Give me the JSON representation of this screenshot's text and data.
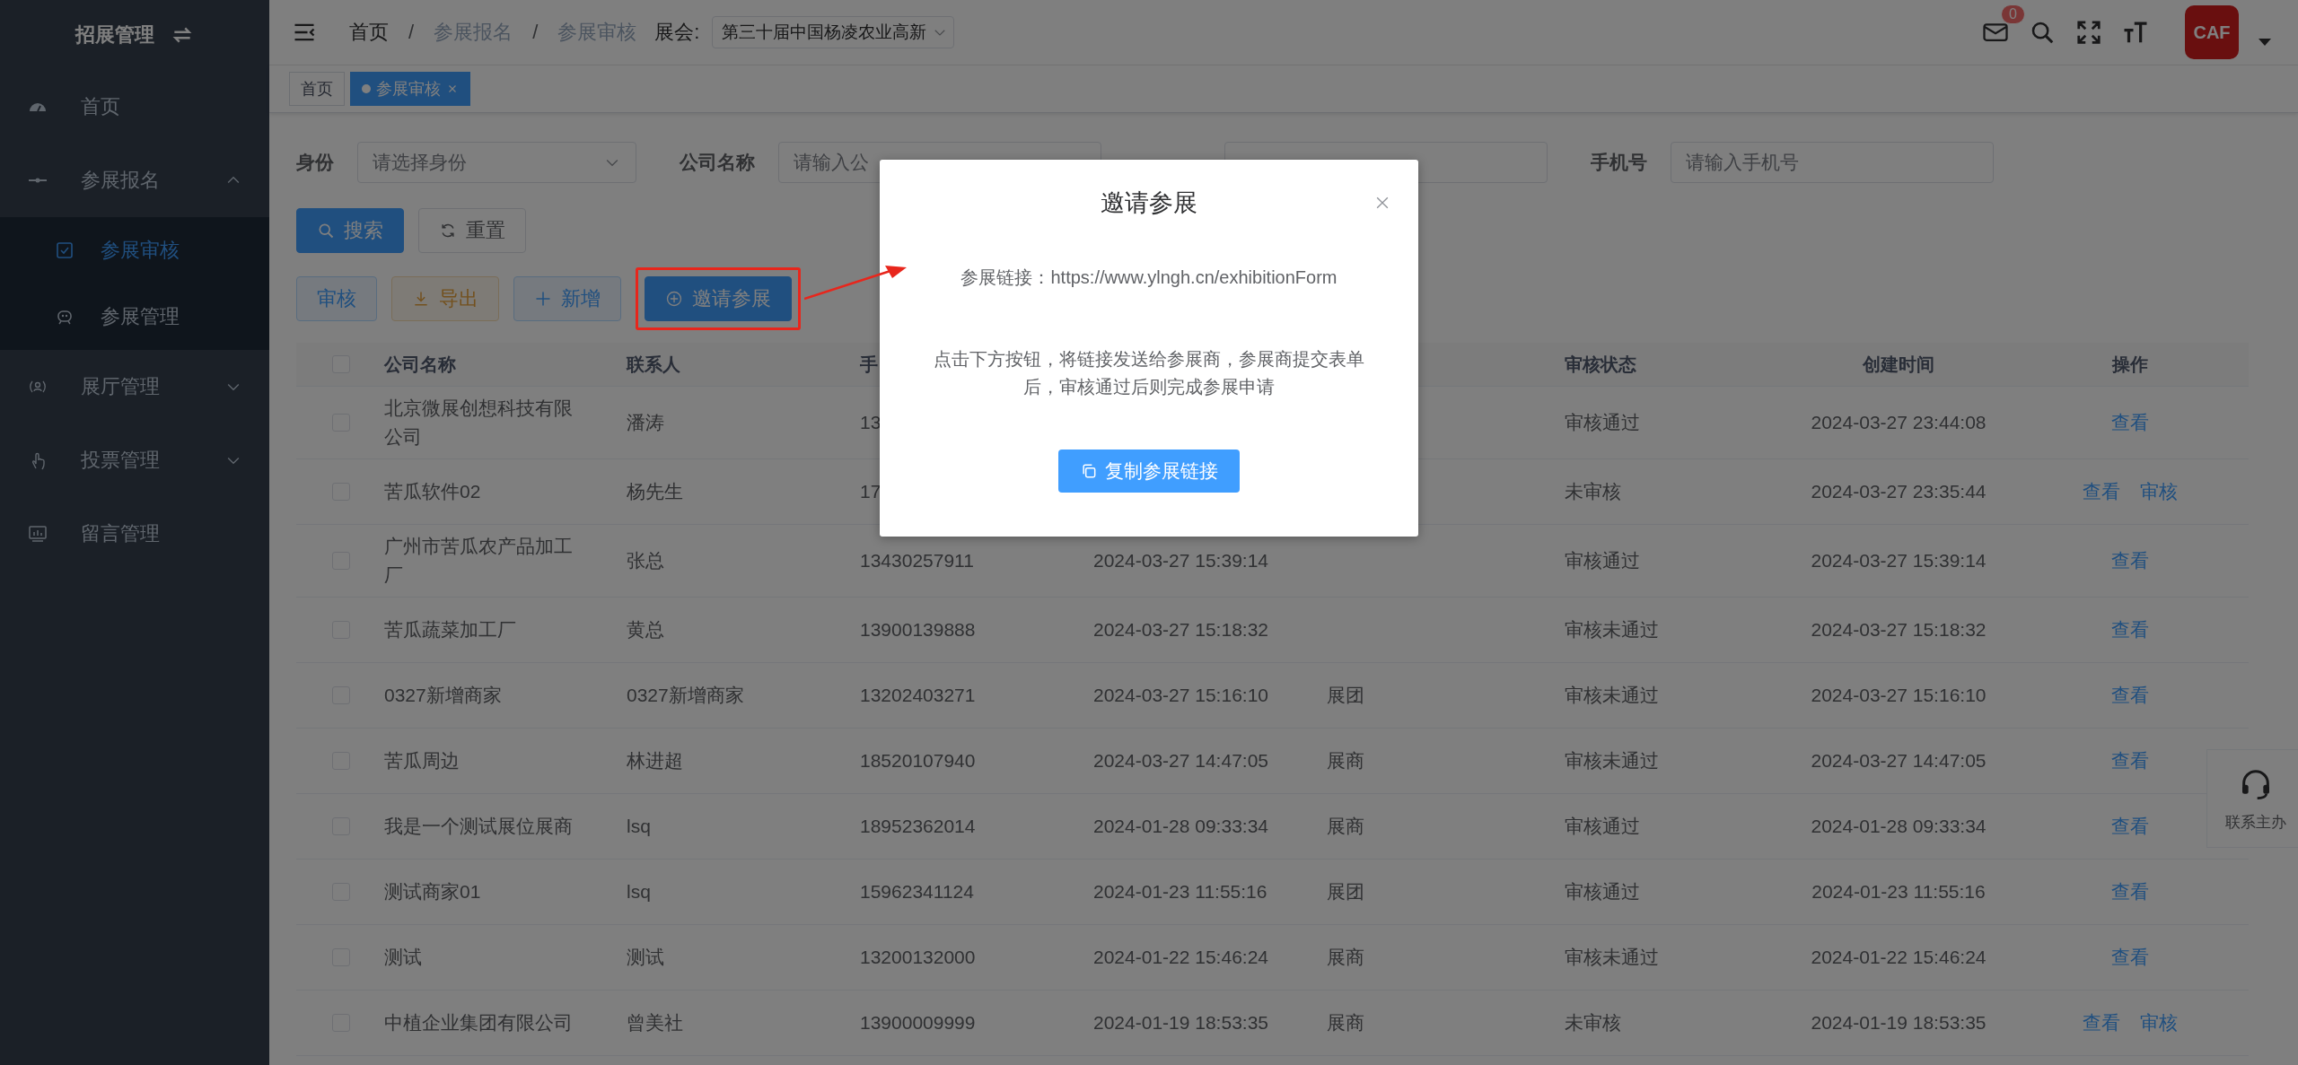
{
  "sidebar": {
    "title": "招展管理",
    "items": [
      {
        "label": "首页",
        "kind": "link",
        "selected": false
      },
      {
        "label": "参展报名",
        "kind": "group",
        "expanded": true,
        "selected": false,
        "children": [
          {
            "label": "参展审核",
            "selected": true
          },
          {
            "label": "参展管理",
            "selected": false
          }
        ]
      },
      {
        "label": "展厅管理",
        "kind": "group",
        "expanded": false,
        "selected": false
      },
      {
        "label": "投票管理",
        "kind": "group",
        "expanded": false,
        "selected": false
      },
      {
        "label": "留言管理",
        "kind": "link",
        "selected": false
      }
    ]
  },
  "breadcrumb": {
    "separator": "/",
    "items": [
      {
        "label": "首页",
        "current": true
      },
      {
        "label": "参展报名",
        "current": false
      },
      {
        "label": "参展审核",
        "current": false
      }
    ]
  },
  "exhibition": {
    "label": "展会:",
    "value": "第三十届中国杨凌农业高新"
  },
  "header": {
    "mail_badge": "0",
    "avatar_text": "CAF"
  },
  "tags": [
    {
      "label": "首页",
      "selected": false
    },
    {
      "label": "参展审核",
      "selected": true,
      "closable": true
    }
  ],
  "filters": [
    {
      "label": "身份",
      "placeholder": "请选择身份",
      "kind": "select"
    },
    {
      "label": "公司名称",
      "placeholder": "请输入公",
      "kind": "input"
    },
    {
      "kind": "input"
    },
    {
      "label": "手机号",
      "placeholder": "请输入手机号",
      "kind": "input"
    }
  ],
  "search_buttons": [
    {
      "label": "搜索",
      "kind": "primary"
    },
    {
      "label": "重置",
      "kind": "default"
    }
  ],
  "actions": [
    {
      "label": "审核",
      "kind": "plain-primary"
    },
    {
      "label": "导出",
      "kind": "plain-warning"
    },
    {
      "label": "新增",
      "kind": "plain-primary"
    },
    {
      "label": "邀请参展",
      "kind": "primary",
      "highlighted": true
    }
  ],
  "table": {
    "select_all_checked": false,
    "columns": [
      {
        "label": "公司名称"
      },
      {
        "label": "联系人"
      },
      {
        "label": "手"
      },
      {},
      {},
      {
        "label": "审核状态"
      },
      {
        "label": "创建时间"
      },
      {
        "label": "操作"
      }
    ],
    "rows": [
      {
        "checked": false,
        "cells": [
          "北京微展创想科技有限公司",
          "潘涛",
          "13",
          null,
          null,
          "审核通过",
          "2024-03-27 23:44:08"
        ],
        "links": [
          "查看"
        ]
      },
      {
        "checked": false,
        "cells": [
          "苦瓜软件02",
          "杨先生",
          "17",
          null,
          null,
          "未审核",
          "2024-03-27 23:35:44"
        ],
        "links": [
          "查看",
          "审核"
        ]
      },
      {
        "checked": false,
        "cells": [
          "广州市苦瓜农产品加工厂",
          "张总",
          "13430257911",
          "2024-03-27 15:39:14",
          null,
          "审核通过",
          "2024-03-27 15:39:14"
        ],
        "links": [
          "查看"
        ]
      },
      {
        "checked": false,
        "cells": [
          "苦瓜蔬菜加工厂",
          "黄总",
          "13900139888",
          "2024-03-27 15:18:32",
          null,
          "审核未通过",
          "2024-03-27 15:18:32"
        ],
        "links": [
          "查看"
        ]
      },
      {
        "checked": false,
        "cells": [
          "0327新增商家",
          "0327新增商家",
          "13202403271",
          "2024-03-27 15:16:10",
          "展团",
          "审核未通过",
          "2024-03-27 15:16:10"
        ],
        "links": [
          "查看"
        ]
      },
      {
        "checked": false,
        "cells": [
          "苦瓜周边",
          "林进超",
          "18520107940",
          "2024-03-27 14:47:05",
          "展商",
          "审核未通过",
          "2024-03-27 14:47:05"
        ],
        "links": [
          "查看"
        ]
      },
      {
        "checked": false,
        "cells": [
          "我是一个测试展位展商",
          "lsq",
          "18952362014",
          "2024-01-28 09:33:34",
          "展商",
          "审核通过",
          "2024-01-28 09:33:34"
        ],
        "links": [
          "查看"
        ]
      },
      {
        "checked": false,
        "cells": [
          "测试商家01",
          "lsq",
          "15962341124",
          "2024-01-23 11:55:16",
          "展团",
          "审核通过",
          "2024-01-23 11:55:16"
        ],
        "links": [
          "查看"
        ]
      },
      {
        "checked": false,
        "cells": [
          "测试",
          "测试",
          "13200132000",
          "2024-01-22 15:46:24",
          "展商",
          "审核未通过",
          "2024-01-22 15:46:24"
        ],
        "links": [
          "查看"
        ]
      },
      {
        "checked": false,
        "cells": [
          "中植企业集团有限公司",
          "曾美社",
          "13900009999",
          "2024-01-19 18:53:35",
          "展商",
          "未审核",
          "2024-01-19 18:53:35"
        ],
        "links": [
          "查看",
          "审核"
        ]
      }
    ]
  },
  "help_widget": {
    "label": "联系主办"
  },
  "modal": {
    "open": true,
    "title": "邀请参展",
    "link_text": "参展链接：https://www.ylngh.cn/exhibitionForm",
    "description": "点击下方按钮，将链接发送给参展商，参展商提交表单后，审核通过后则完成参展申请",
    "button": "复制参展链接"
  }
}
